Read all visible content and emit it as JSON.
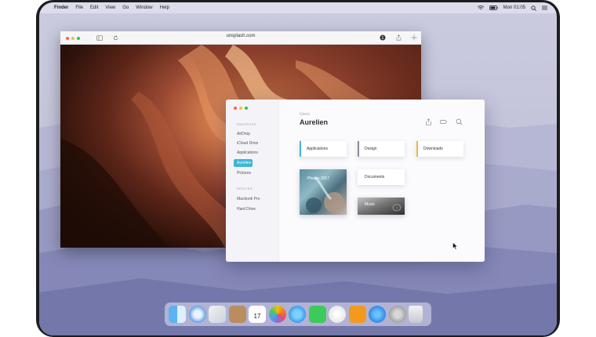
{
  "menubar": {
    "app_name": "Finder",
    "menus": [
      "File",
      "Edit",
      "View",
      "Go",
      "Window",
      "Help"
    ],
    "clock": "Mon 01:05"
  },
  "safari": {
    "url": "unsplash.com"
  },
  "finder": {
    "sidebar": {
      "favorites_heading": "FAVORITES",
      "favorites": [
        "AirDrop",
        "iCloud Drive",
        "Applications",
        "Aurelien",
        "Pictures"
      ],
      "devices_heading": "DEVICES",
      "devices": [
        "Macbook Pro",
        "Hard Drive"
      ]
    },
    "breadcrumb": "Users",
    "title": "Aurelien",
    "folders": [
      {
        "label": "Applications",
        "color": "#3fb6d6"
      },
      {
        "label": "Design",
        "color": "#8a8a96"
      },
      {
        "label": "Downloads",
        "color": "#f2b544"
      },
      {
        "label": "Documents",
        "color": "#ffffff"
      }
    ],
    "tiles": [
      {
        "label": "Photos 2017"
      },
      {
        "label": "Music"
      }
    ]
  },
  "colors": {
    "accent": "#3fb6d6",
    "close": "#fd5f57",
    "minimize": "#febc2e",
    "zoom": "#28c840"
  }
}
